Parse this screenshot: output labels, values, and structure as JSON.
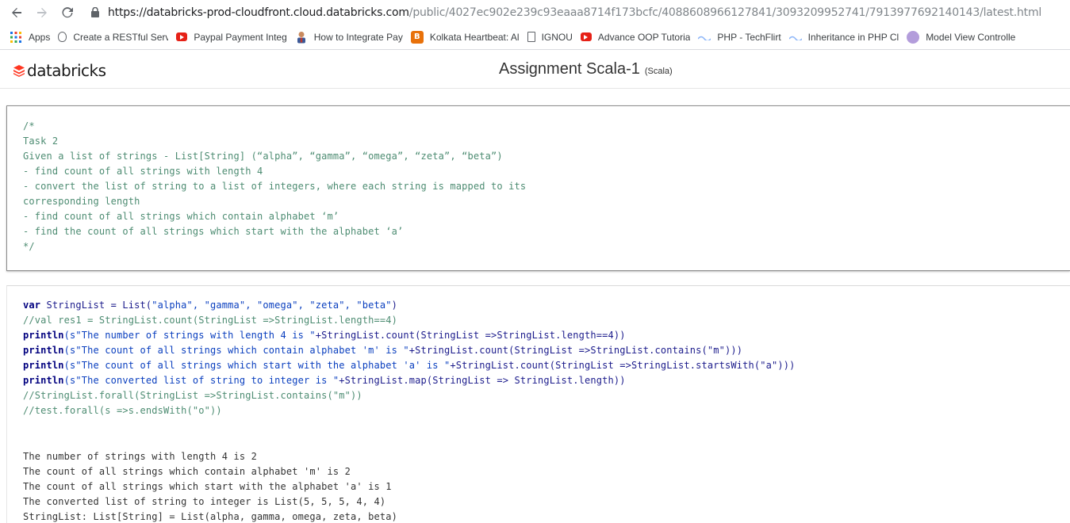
{
  "browser": {
    "url_host": "https://databricks-prod-cloudfront.cloud.databricks.com",
    "url_path": "/public/4027ec902e239c93eaaa8714f173bcfc/4088608966127841/3093209952741/7913977692140143/latest.html",
    "bookmarks": [
      {
        "label": "Apps",
        "icon": "apps-grid-icon"
      },
      {
        "label": "Create a RESTful Serv",
        "icon": "bulb-icon"
      },
      {
        "label": "Paypal Payment Integ",
        "icon": "youtube-icon"
      },
      {
        "label": "How to Integrate Pay",
        "icon": "avatar-icon"
      },
      {
        "label": "Kolkata Heartbeat: Al",
        "icon": "blogger-icon"
      },
      {
        "label": "IGNOU",
        "icon": "document-icon"
      },
      {
        "label": "Advance OOP Tutoria",
        "icon": "youtube-icon"
      },
      {
        "label": "PHP - TechFlirt",
        "icon": "techflirt-icon"
      },
      {
        "label": "Inheritance in PHP Cl",
        "icon": "techflirt-icon"
      },
      {
        "label": "Model View Controlle",
        "icon": "mvc-icon"
      }
    ]
  },
  "header": {
    "logo_text": "databricks",
    "title": "Assignment Scala-1",
    "language": "(Scala)"
  },
  "cell1": {
    "lines": [
      "/*",
      "Task 2",
      "Given a list of strings - List[String] (“alpha”, “gamma”, “omega”, “zeta”, “beta”)",
      "- find count of all strings with length 4",
      "- convert the list of string to a list of integers, where each string is mapped to its",
      "corresponding length",
      "- find count of all strings which contain alphabet ‘m’",
      "- find the count of all strings which start with the alphabet ‘a’",
      "*/"
    ]
  },
  "cell2": {
    "code": {
      "l1_kw": "var",
      "l1_rest": " StringList = List(",
      "l1_str": "\"alpha\", \"gamma\", \"omega\", \"zeta\", \"beta\"",
      "l1_end": ")",
      "l2": "//val res1 = StringList.count(StringList =>StringList.length==4)",
      "l3_kw": "println",
      "l3_str": "(s\"The number of strings with length 4 is \"",
      "l3_rest": "+StringList.count(StringList =>StringList.length==4))",
      "l4_kw": "println",
      "l4_str": "(s\"The count of all strings which contain alphabet 'm' is \"",
      "l4_rest": "+StringList.count(StringList =>StringList.contains(\"m\")))",
      "l5_kw": "println",
      "l5_str": "(s\"The count of all strings which start with the alphabet 'a' is \"",
      "l5_rest": "+StringList.count(StringList =>StringList.startsWith(\"a\")))",
      "l6_kw": "println",
      "l6_str": "(s\"The converted list of string to integer is \"",
      "l6_rest": "+StringList.map(StringList => StringList.length))",
      "l7": "//StringList.forall(StringList =>StringList.contains(\"m\"))",
      "l8": "//test.forall(s =>s.endsWith(\"o\"))"
    },
    "output": [
      "The number of strings with length 4 is 2",
      "The count of all strings which contain alphabet 'm' is 2",
      "The count of all strings which start with the alphabet 'a' is 1",
      "The converted list of string to integer is List(5, 5, 5, 4, 4)",
      "StringList: List[String] = List(alpha, gamma, omega, zeta, beta)"
    ]
  }
}
